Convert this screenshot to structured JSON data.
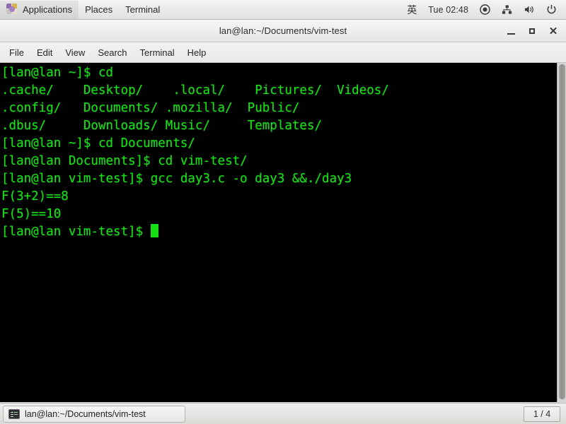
{
  "top_panel": {
    "apps_icon": "applications-icon",
    "menus": [
      {
        "label": "Applications",
        "name": "panel-menu-applications"
      },
      {
        "label": "Places",
        "name": "panel-menu-places"
      },
      {
        "label": "Terminal",
        "name": "panel-menu-terminal"
      }
    ],
    "tray": {
      "input_method": "英",
      "clock": "Tue 02:48",
      "icons": [
        "record-circle-icon",
        "network-icon",
        "volume-icon",
        "power-icon"
      ]
    }
  },
  "window": {
    "title": "lan@lan:~/Documents/vim-test",
    "buttons": {
      "minimize": "minimize-button",
      "maximize": "maximize-button",
      "close": "close-button"
    },
    "menubar": [
      {
        "label": "File",
        "name": "menu-file"
      },
      {
        "label": "Edit",
        "name": "menu-edit"
      },
      {
        "label": "View",
        "name": "menu-view"
      },
      {
        "label": "Search",
        "name": "menu-search"
      },
      {
        "label": "Terminal",
        "name": "menu-terminal"
      },
      {
        "label": "Help",
        "name": "menu-help"
      }
    ]
  },
  "terminal": {
    "foreground_color": "#18e018",
    "background_color": "#000000",
    "lines": [
      "[lan@lan ~]$ cd",
      ".cache/    Desktop/    .local/    Pictures/  Videos/",
      ".config/   Documents/ .mozilla/  Public/",
      ".dbus/     Downloads/ Music/     Templates/",
      "[lan@lan ~]$ cd Documents/",
      "[lan@lan Documents]$ cd vim-test/",
      "[lan@lan vim-test]$ gcc day3.c -o day3 &&./day3",
      "F(3+2)==8",
      "F(5)==10"
    ],
    "prompt": "[lan@lan vim-test]$ ",
    "cursor": "block-cursor"
  },
  "bottom_panel": {
    "task": {
      "icon": "terminal-icon",
      "label": "lan@lan:~/Documents/vim-test"
    },
    "workspace": "1 / 4"
  }
}
